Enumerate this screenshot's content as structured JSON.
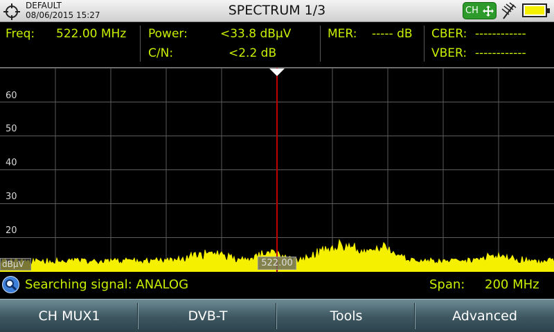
{
  "header": {
    "profile_name": "DEFAULT",
    "datetime": "08/06/2015 15:27",
    "title": "SPECTRUM 1/3",
    "ch_button_label": "CH"
  },
  "measurements": {
    "freq_label": "Freq:",
    "freq_value": "522.00 MHz",
    "power_label": "Power:",
    "power_value": "<33.8 dBµV",
    "cn_label": "C/N:",
    "cn_value": "<2.2 dB",
    "mer_label": "MER:",
    "mer_value": "----- dB",
    "cber_label": "CBER:",
    "cber_value": "------------",
    "vber_label": "VBER:",
    "vber_value": "------------"
  },
  "spectrum": {
    "y_ticks": [
      "60",
      "50",
      "40",
      "30",
      "20"
    ],
    "unit_label": "dBµV",
    "marker_label": "522.00"
  },
  "status": {
    "message": "Searching signal: ANALOG",
    "span_label": "Span:",
    "span_value": "200 MHz"
  },
  "softkeys": [
    {
      "label": "CH MUX1"
    },
    {
      "label": "DVB-T"
    },
    {
      "label": "Tools"
    },
    {
      "label": "Advanced"
    }
  ],
  "colors": {
    "value_text": "#c8f000",
    "trace": "#f5ef00",
    "marker": "#c00000"
  }
}
